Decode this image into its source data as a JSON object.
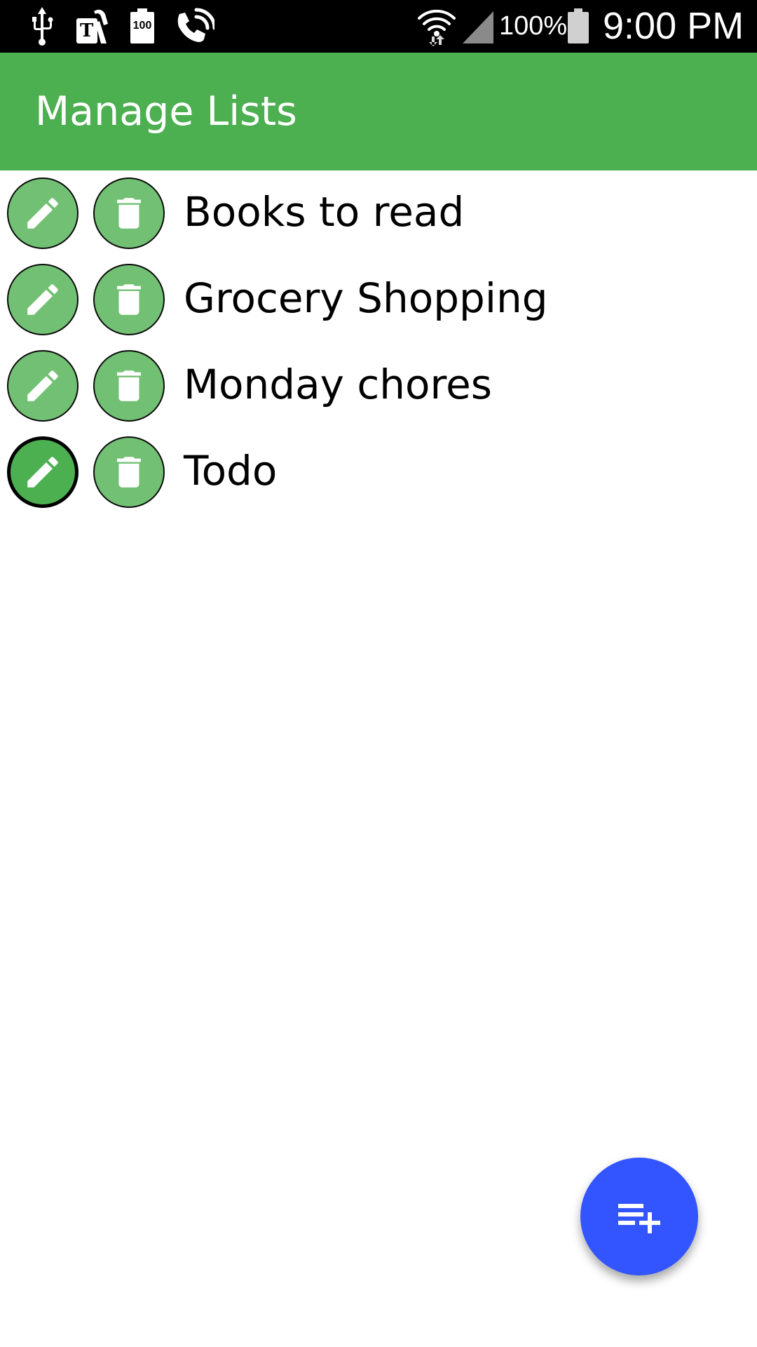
{
  "status_bar": {
    "battery_percent_text": "100%",
    "time": "9:00 PM",
    "battery_saver_badge": "100",
    "carrier_glyph": "T",
    "icons": [
      "usb-icon",
      "tmobile-icon",
      "battery-saver-icon",
      "wifi-calling-icon",
      "wifi-icon",
      "signal-icon",
      "battery-icon"
    ]
  },
  "app_bar": {
    "title": "Manage Lists",
    "color": "#4caf50"
  },
  "lists": {
    "items": [
      {
        "label": "Books to read",
        "edit_icon": "pencil-icon",
        "delete_icon": "trash-icon",
        "edit_focused": false
      },
      {
        "label": "Grocery Shopping",
        "edit_icon": "pencil-icon",
        "delete_icon": "trash-icon",
        "edit_focused": false
      },
      {
        "label": "Monday chores",
        "edit_icon": "pencil-icon",
        "delete_icon": "trash-icon",
        "edit_focused": false
      },
      {
        "label": "Todo",
        "edit_icon": "pencil-icon",
        "delete_icon": "trash-icon",
        "edit_focused": true
      }
    ],
    "button_color": "#72c074",
    "focused_button_color": "#4caf50"
  },
  "fab": {
    "icon": "playlist-add-icon",
    "color": "#3355ff"
  }
}
